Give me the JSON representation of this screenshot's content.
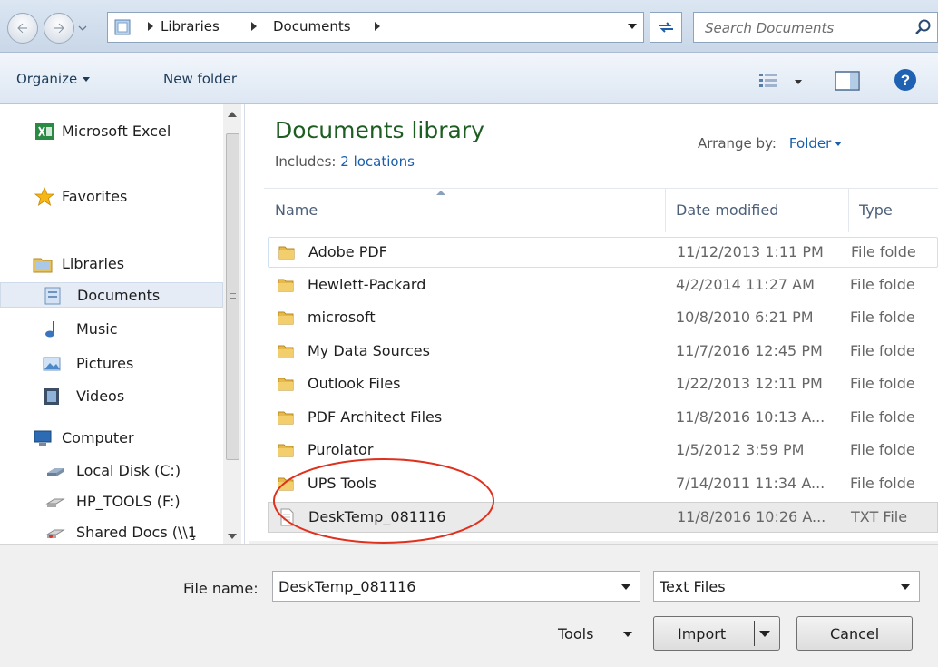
{
  "address_bar": {
    "breadcrumbs": [
      "Libraries",
      "Documents"
    ],
    "search_placeholder": "Search Documents"
  },
  "toolbar": {
    "organize_label": "Organize",
    "new_folder_label": "New folder"
  },
  "navigation": {
    "items": [
      {
        "label": "Microsoft Excel",
        "icon": "excel-icon"
      },
      {
        "label": "Favorites",
        "icon": "star-icon"
      },
      {
        "label": "Libraries",
        "icon": "libraries-icon"
      },
      {
        "label": "Documents",
        "icon": "documents-icon",
        "selected": true
      },
      {
        "label": "Music",
        "icon": "music-icon"
      },
      {
        "label": "Pictures",
        "icon": "pictures-icon"
      },
      {
        "label": "Videos",
        "icon": "videos-icon"
      },
      {
        "label": "Computer",
        "icon": "computer-icon"
      },
      {
        "label": "Local Disk (C:)",
        "icon": "disk-icon"
      },
      {
        "label": "HP_TOOLS (F:)",
        "icon": "drive-icon"
      },
      {
        "label": "Shared Docs (\\\\1̧",
        "icon": "network-drive-icon"
      }
    ]
  },
  "library": {
    "title": "Documents library",
    "includes_label": "Includes:",
    "includes_link": "2 locations",
    "arrange_label": "Arrange by:",
    "arrange_value": "Folder"
  },
  "columns": {
    "name": "Name",
    "date": "Date modified",
    "type": "Type"
  },
  "files": [
    {
      "name": "Adobe PDF",
      "date": "11/12/2013 1:11 PM",
      "type": "File folde",
      "kind": "folder"
    },
    {
      "name": "Hewlett-Packard",
      "date": "4/2/2014 11:27 AM",
      "type": "File folde",
      "kind": "folder"
    },
    {
      "name": "microsoft",
      "date": "10/8/2010 6:21 PM",
      "type": "File folde",
      "kind": "folder"
    },
    {
      "name": "My Data Sources",
      "date": "11/7/2016 12:45 PM",
      "type": "File folde",
      "kind": "folder"
    },
    {
      "name": "Outlook Files",
      "date": "1/22/2013 12:11 PM",
      "type": "File folde",
      "kind": "folder"
    },
    {
      "name": "PDF Architect Files",
      "date": "11/8/2016 10:13 A...",
      "type": "File folde",
      "kind": "folder"
    },
    {
      "name": "Purolator",
      "date": "1/5/2012 3:59 PM",
      "type": "File folde",
      "kind": "folder"
    },
    {
      "name": "UPS Tools",
      "date": "7/14/2011 11:34 A...",
      "type": "File folde",
      "kind": "folder"
    },
    {
      "name": "DeskTemp_081116",
      "date": "11/8/2016 10:26 A...",
      "type": "TXT File",
      "kind": "text"
    }
  ],
  "bottom": {
    "file_name_label": "File name:",
    "file_name_value": "DeskTemp_081116",
    "file_type_value": "Text Files",
    "tools_label": "Tools",
    "import_label": "Import",
    "cancel_label": "Cancel"
  },
  "colors": {
    "accent_green": "#1e5d22",
    "link_blue": "#1a5dab",
    "annotation_red": "#e0301e"
  }
}
